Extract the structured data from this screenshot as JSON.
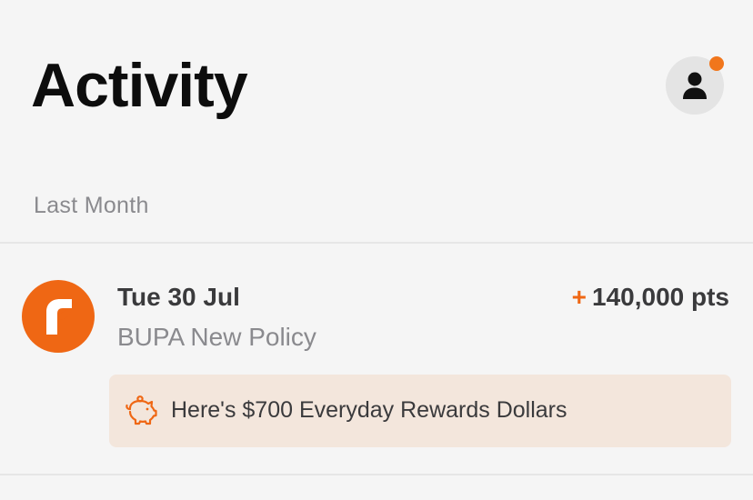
{
  "header": {
    "title": "Activity",
    "profile_icon": "person-icon",
    "notification_color": "#f1761c"
  },
  "sections": [
    {
      "label": "Last Month",
      "items": [
        {
          "icon": "rewards-r-logo-icon",
          "date": "Tue 30 Jul",
          "description": "BUPA New Policy",
          "points_sign": "+",
          "points": "140,000 pts",
          "reward": {
            "icon": "piggy-bank-icon",
            "text": "Here's $700 Everyday Rewards Dollars"
          }
        }
      ]
    }
  ],
  "colors": {
    "accent": "#ef6714",
    "background": "#f5f5f5",
    "banner_background": "#f3e6dc",
    "text_primary": "#3a3a3c",
    "text_secondary": "#8a8a8e"
  }
}
